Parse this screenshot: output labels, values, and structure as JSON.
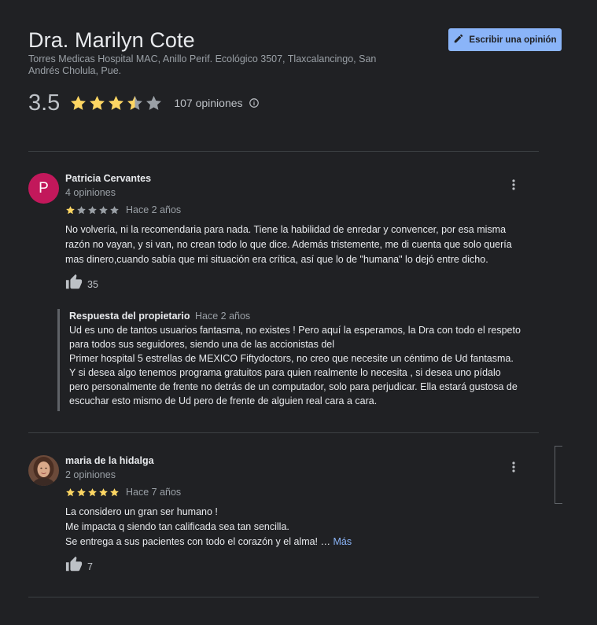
{
  "header": {
    "title": "Dra. Marilyn Cote",
    "address": "Torres Medicas Hospital MAC, Anillo Perif. Ecológico 3507, Tlaxcalancingo, San Andrés Cholula, Pue.",
    "write_review_label": "Escribir una opinión",
    "rating_value": "3.5",
    "rating_numeric": 3.5,
    "reviews_count_label": "107 opiniones"
  },
  "reviews": [
    {
      "avatar_letter": "P",
      "author": "Patricia Cervantes",
      "author_meta": "4 opiniones",
      "stars": 1,
      "time": "Hace 2 años",
      "text_lines": [
        "No volvería, ni la recomendaria para nada. Tiene la habilidad de enredar y convencer, por esa misma",
        "razón no vayan, y si van, no crean todo lo que dice. Además tristemente, me di cuenta que solo quería",
        "mas dinero,cuando sabía que mi situación era crítica, así que lo de \"humana\" lo dejó entre dicho."
      ],
      "likes": "35",
      "owner_reply": {
        "label": "Respuesta del propietario",
        "time": "Hace 2 años",
        "text_lines": [
          "Ud es uno de tantos usuarios fantasma, no existes ! Pero aquí la esperamos, la Dra con todo el respeto",
          "para todos sus seguidores, siendo una de las accionistas del",
          "Primer hospital 5 estrellas de MEXICO Fiftydoctors, no creo que necesite un céntimo de Ud fantasma.",
          "Y si desea algo tenemos programa gratuitos para quien realmente lo necesita , si desea uno pídalo",
          "pero personalmente de frente no detrás de un computador, solo para perjudicar. Ella estará gustosa de",
          "escuchar esto mismo de Ud pero de frente de alguien real cara a cara."
        ]
      }
    },
    {
      "author": "maria de la hidalga",
      "author_meta": "2 opiniones",
      "stars": 5,
      "time": "Hace 7 años",
      "text_lines": [
        "La considero un gran ser humano !",
        "Me impacta q siendo tan calificada sea tan sencilla.",
        "Se entrega a sus pacientes con todo el corazón y el alma! …"
      ],
      "more_label": "Más",
      "likes": "7"
    }
  ],
  "colors": {
    "star_filled": "#fdd663",
    "star_empty": "#9aa0a6",
    "accent": "#8ab4f8",
    "avatar_bg": "#c2185b"
  },
  "icons": {
    "write": "pencil-icon",
    "info": "info-icon",
    "like": "thumb-up-icon",
    "menu": "more-vert-icon"
  }
}
